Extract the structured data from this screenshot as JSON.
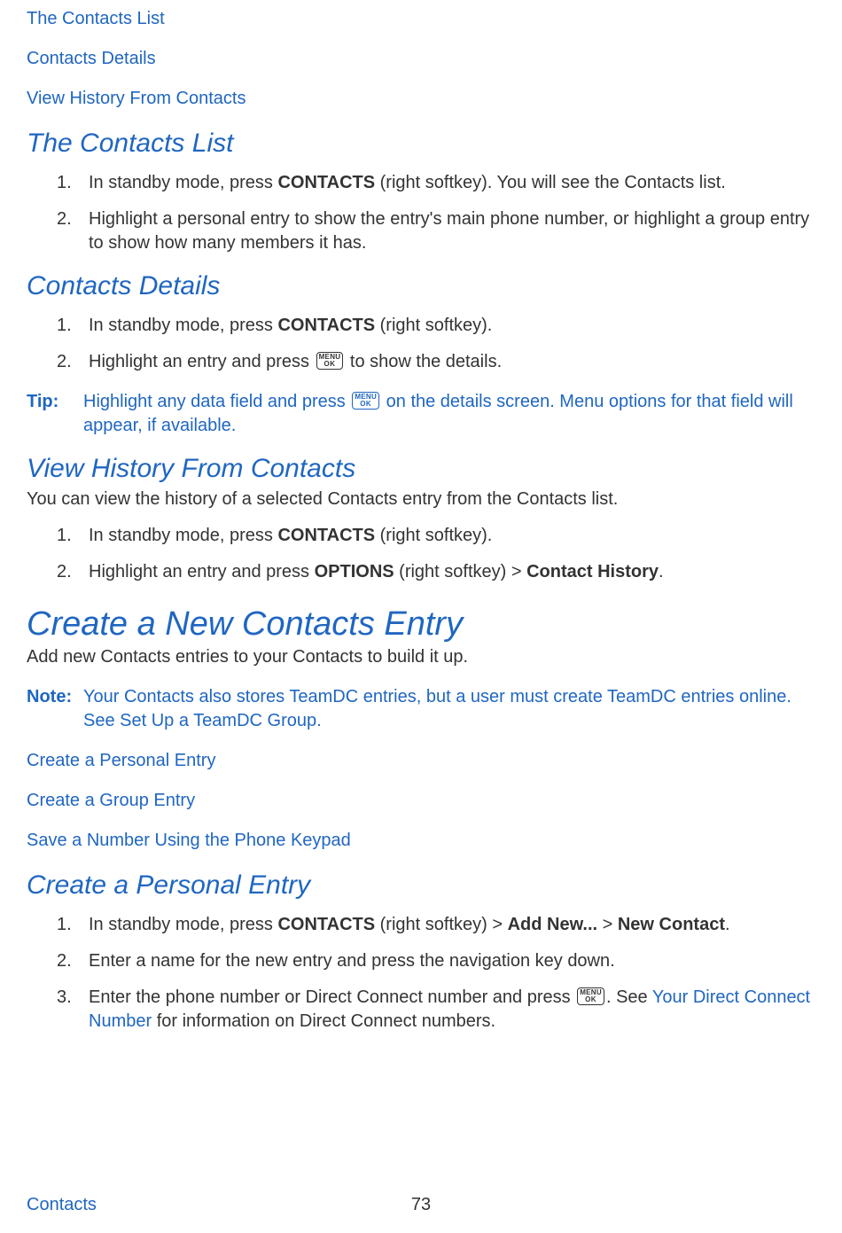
{
  "toc": {
    "link1": "The Contacts List",
    "link2": "Contacts Details",
    "link3": "View History From Contacts"
  },
  "section1": {
    "heading": "The Contacts List",
    "step1_pre": "In standby mode, press ",
    "step1_b1": "CONTACTS",
    "step1_post": " (right softkey). You will see the Contacts list.",
    "step2": "Highlight a personal entry to show the entry's main phone number, or highlight a group entry to show how many members it has."
  },
  "section2": {
    "heading": "Contacts Details",
    "step1_pre": "In standby mode, press ",
    "step1_b1": "CONTACTS",
    "step1_post": " (right softkey).",
    "step2_pre": "Highlight an entry and press ",
    "step2_post": " to show the details.",
    "tip_label": "Tip:",
    "tip_pre": "Highlight any data field and press ",
    "tip_post": " on the details screen. Menu options for that field will appear, if available."
  },
  "section3": {
    "heading": "View History From Contacts",
    "intro": "You can view the history of a selected Contacts entry from the Contacts list.",
    "step1_pre": "In standby mode, press ",
    "step1_b1": "CONTACTS",
    "step1_post": " (right softkey).",
    "step2_pre": "Highlight an entry and press ",
    "step2_b1": "OPTIONS",
    "step2_mid": " (right softkey) > ",
    "step2_b2": "Contact History",
    "step2_post": "."
  },
  "section4": {
    "heading": "Create a New Contacts Entry",
    "intro": "Add new Contacts entries to your Contacts to build it up.",
    "note_label": "Note:",
    "note_pre": "Your Contacts also stores TeamDC entries, but a user must create TeamDC entries online. See ",
    "note_link": "Set Up a TeamDC Group",
    "note_post": "."
  },
  "toc2": {
    "link1": "Create a Personal Entry",
    "link2": "Create a Group Entry",
    "link3": "Save a Number Using the Phone Keypad"
  },
  "section5": {
    "heading": "Create a Personal Entry",
    "step1_pre": "In standby mode, press ",
    "step1_b1": "CONTACTS",
    "step1_mid1": " (right softkey) > ",
    "step1_b2": "Add New...",
    "step1_mid2": " > ",
    "step1_b3": "New Contact",
    "step1_post": ".",
    "step2": "Enter a name for the new entry and press the navigation key down.",
    "step3_pre": "Enter the phone number or Direct Connect number and press ",
    "step3_mid": ". See ",
    "step3_link": "Your Direct Connect Number",
    "step3_post": " for information on Direct Connect numbers."
  },
  "footer": {
    "section": "Contacts",
    "page": "73"
  },
  "icon": {
    "l1": "MENU",
    "l2": "OK"
  }
}
